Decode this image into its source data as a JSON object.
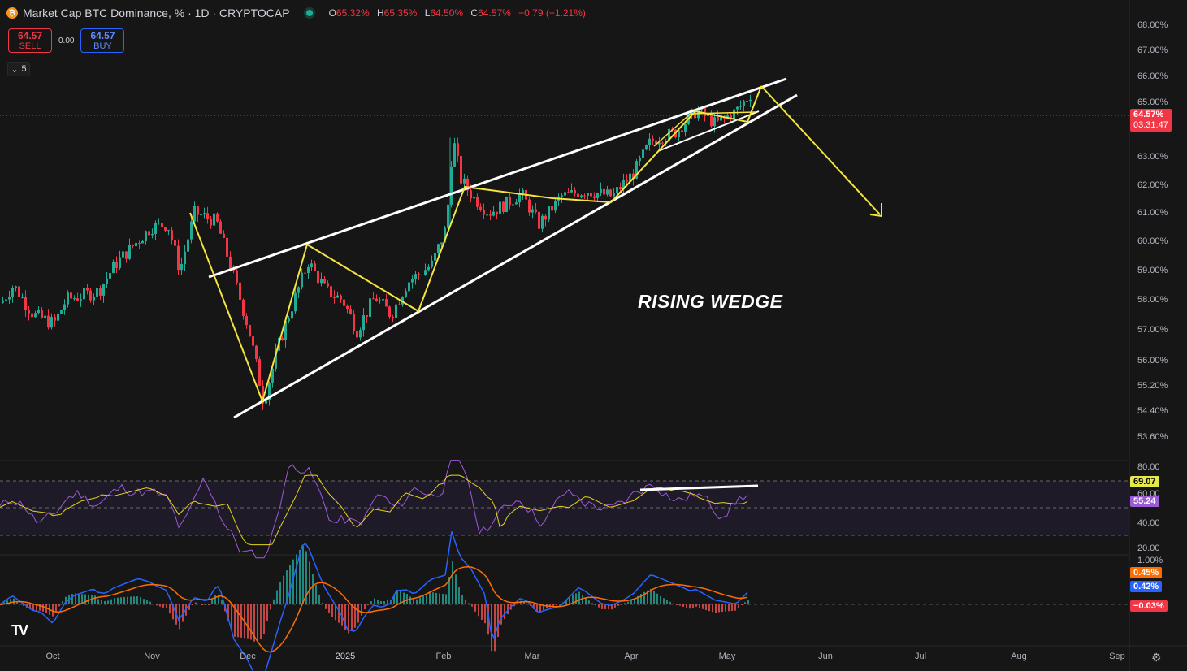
{
  "header": {
    "title": "Market Cap BTC Dominance, % · 1D · CRYPTOCAP",
    "ohlc": [
      {
        "k": "O",
        "v": "65.32%"
      },
      {
        "k": "H",
        "v": "65.35%"
      },
      {
        "k": "L",
        "v": "64.50%"
      },
      {
        "k": "C",
        "v": "64.57%"
      },
      {
        "k": "",
        "v": "−0.79 (−1.21%)"
      }
    ]
  },
  "trade": {
    "sell_price": "64.57",
    "sell_label": "SELL",
    "spread": "0.00",
    "buy_price": "64.57",
    "buy_label": "BUY"
  },
  "indicators_count": "5",
  "price_axis": [
    "68.00%",
    "67.00%",
    "66.00%",
    "65.00%",
    "63.00%",
    "62.00%",
    "61.00%",
    "60.00%",
    "59.00%",
    "58.00%",
    "57.00%",
    "56.00%",
    "55.20%",
    "54.40%",
    "53.60%"
  ],
  "price_tag": {
    "price": "64.57%",
    "countdown": "03:31:47"
  },
  "rsi_axis": [
    "80.00",
    "60.00",
    "40.00",
    "20.00"
  ],
  "rsi_tags": {
    "ma": "69.07",
    "rsi": "55.24"
  },
  "macd_axis": [
    "1.00%"
  ],
  "macd_tags": {
    "signal": "0.45%",
    "macd": "0.42%",
    "hist": "−0.03%"
  },
  "time_axis": [
    "Oct",
    "Nov",
    "Dec",
    "2025",
    "Feb",
    "Mar",
    "Apr",
    "May",
    "Jun",
    "Jul",
    "Aug",
    "Sep"
  ],
  "annotation": "RISING WEDGE",
  "colors": {
    "up": "#22ab94",
    "down": "#f23645",
    "rsi": "#9c5bd6",
    "rsi_ma": "#e6d31a",
    "wedge": "#ffffff",
    "zigzag": "#f5e43b",
    "macd": "#2962ff",
    "signal": "#ff6d00"
  },
  "chart_data": [
    {
      "type": "line",
      "title": "Market Cap BTC Dominance, % · 1D · CRYPTOCAP",
      "ylabel": "%",
      "ylim": [
        53.3,
        68.3
      ],
      "x": [
        "Oct",
        "Nov",
        "Dec",
        "2025",
        "Feb",
        "Mar",
        "Apr",
        "May"
      ],
      "series": [
        {
          "values": [
            57.8,
            59.8,
            55.0,
            58.2,
            61.6,
            61.0,
            61.8,
            64.57
          ]
        }
      ],
      "annotation": "RISING WEDGE"
    },
    {
      "type": "line",
      "ylim": [
        20,
        80
      ],
      "series": [
        {
          "values": [
            55.24
          ]
        },
        {
          "values": [
            69.07
          ]
        }
      ]
    },
    {
      "type": "bar",
      "ylim": [
        -1.2,
        1.0
      ],
      "series": [
        {
          "values": [
            0.42
          ]
        },
        {
          "values": [
            0.45
          ]
        },
        {
          "values": [
            -0.03
          ]
        }
      ]
    }
  ]
}
